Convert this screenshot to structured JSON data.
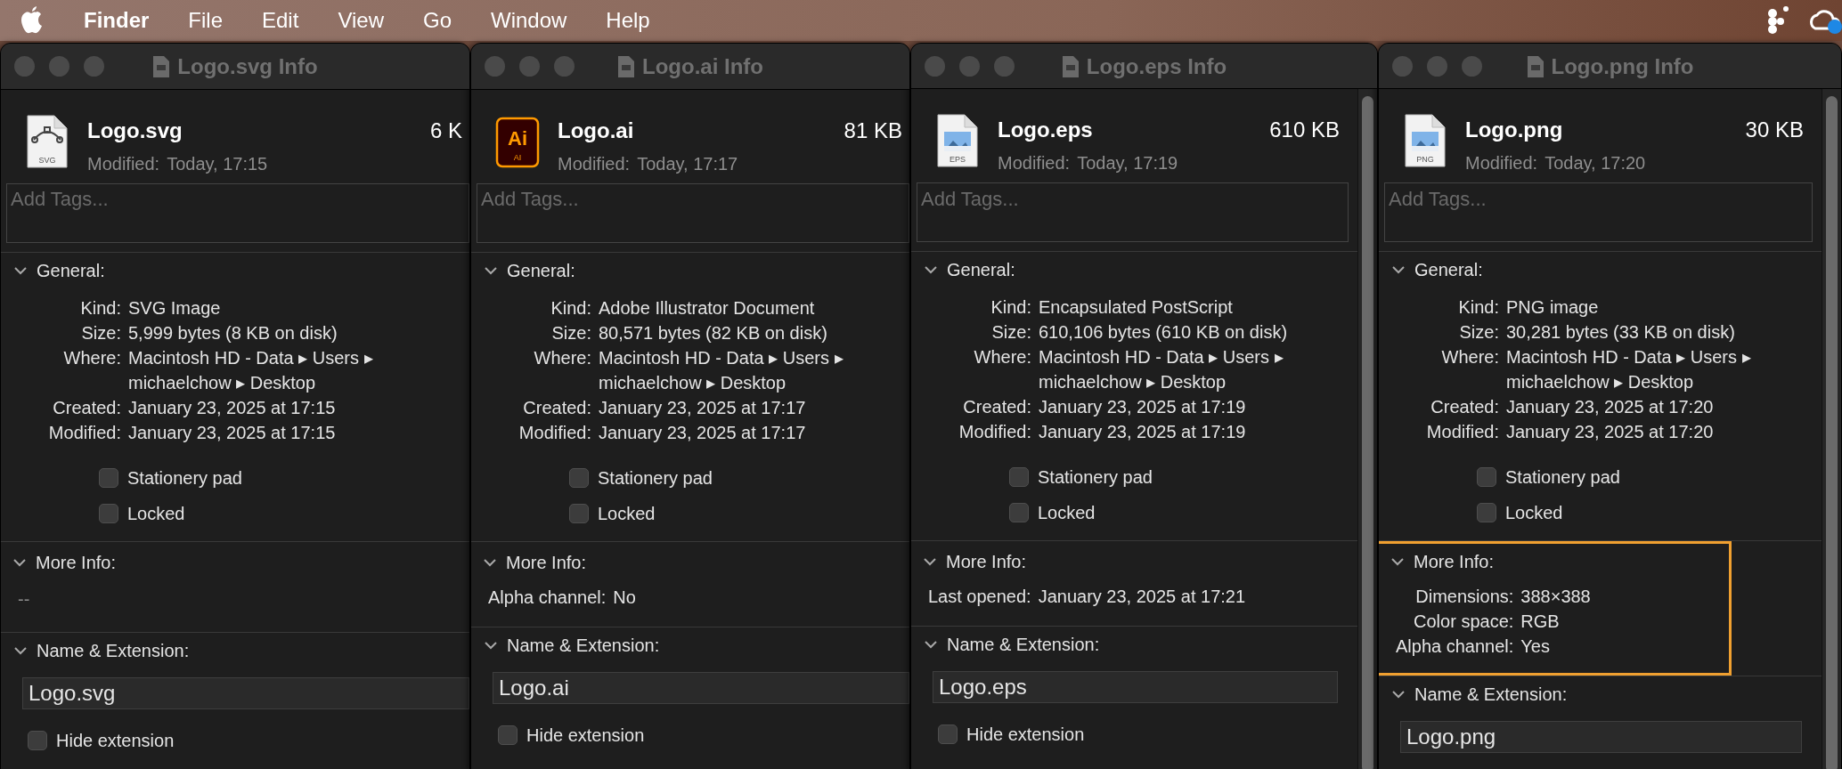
{
  "menu_bar": {
    "app_name": "Finder",
    "items": [
      "File",
      "Edit",
      "View",
      "Go",
      "Window",
      "Help"
    ]
  },
  "windows": [
    {
      "title": "Logo.svg Info",
      "kind": "svg",
      "icon_text": [
        "SVG"
      ],
      "name": "Logo.svg",
      "size": "6 K",
      "modified_label": "Modified:",
      "modified": "Today, 17:15",
      "tags_placeholder": "Add Tags...",
      "scrollbar": false,
      "general": {
        "heading": "General:",
        "expanded": true,
        "rows": [
          {
            "label": "Kind:",
            "value": "SVG Image"
          },
          {
            "label": "Size:",
            "value": "5,999 bytes (8 KB on disk)"
          },
          {
            "label": "Where:",
            "value": "Macintosh HD - Data ▸ Users ▸ michaelchow ▸ Desktop"
          },
          {
            "label": "Created:",
            "value": "January 23, 2025 at 17:15"
          },
          {
            "label": "Modified:",
            "value": "January 23, 2025 at 17:15"
          }
        ],
        "checkboxes": [
          {
            "label": "Stationery pad",
            "checked": false
          },
          {
            "label": "Locked",
            "checked": false
          }
        ]
      },
      "more_info": {
        "heading": "More Info:",
        "expanded": true,
        "highlighted": false,
        "note": "--"
      },
      "name_extension": {
        "heading": "Name & Extension:",
        "expanded": true,
        "value": "Logo.svg",
        "hide_extension": {
          "label": "Hide extension",
          "checked": false
        }
      }
    },
    {
      "title": "Logo.ai Info",
      "kind": "ai",
      "icon_text": [
        "Ai",
        "AI"
      ],
      "name": "Logo.ai",
      "size": "81 KB",
      "modified_label": "Modified:",
      "modified": "Today, 17:17",
      "tags_placeholder": "Add Tags...",
      "scrollbar": false,
      "general": {
        "heading": "General:",
        "expanded": true,
        "rows": [
          {
            "label": "Kind:",
            "value": "Adobe Illustrator Document"
          },
          {
            "label": "Size:",
            "value": "80,571 bytes (82 KB on disk)"
          },
          {
            "label": "Where:",
            "value": "Macintosh HD - Data ▸ Users ▸ michaelchow ▸ Desktop"
          },
          {
            "label": "Created:",
            "value": "January 23, 2025 at 17:17"
          },
          {
            "label": "Modified:",
            "value": "January 23, 2025 at 17:17"
          }
        ],
        "checkboxes": [
          {
            "label": "Stationery pad",
            "checked": false
          },
          {
            "label": "Locked",
            "checked": false
          }
        ]
      },
      "more_info": {
        "heading": "More Info:",
        "expanded": true,
        "highlighted": false,
        "rows": [
          {
            "label": "Alpha channel:",
            "value": "No"
          }
        ]
      },
      "name_extension": {
        "heading": "Name & Extension:",
        "expanded": true,
        "value": "Logo.ai",
        "hide_extension": {
          "label": "Hide extension",
          "checked": false
        }
      }
    },
    {
      "title": "Logo.eps Info",
      "kind": "eps",
      "icon_text": [
        "EPS"
      ],
      "name": "Logo.eps",
      "size": "610 KB",
      "modified_label": "Modified:",
      "modified": "Today, 17:19",
      "tags_placeholder": "Add Tags...",
      "scrollbar": true,
      "general": {
        "heading": "General:",
        "expanded": true,
        "rows": [
          {
            "label": "Kind:",
            "value": "Encapsulated PostScript"
          },
          {
            "label": "Size:",
            "value": "610,106 bytes (610 KB on disk)"
          },
          {
            "label": "Where:",
            "value": "Macintosh HD - Data ▸ Users ▸ michaelchow ▸ Desktop"
          },
          {
            "label": "Created:",
            "value": "January 23, 2025 at 17:19"
          },
          {
            "label": "Modified:",
            "value": "January 23, 2025 at 17:19"
          }
        ],
        "checkboxes": [
          {
            "label": "Stationery pad",
            "checked": false
          },
          {
            "label": "Locked",
            "checked": false
          }
        ]
      },
      "more_info": {
        "heading": "More Info:",
        "expanded": true,
        "highlighted": false,
        "rows": [
          {
            "label": "Last opened:",
            "value": "January 23, 2025 at 17:21"
          }
        ]
      },
      "name_extension": {
        "heading": "Name & Extension:",
        "expanded": true,
        "value": "Logo.eps",
        "hide_extension": {
          "label": "Hide extension",
          "checked": false
        }
      }
    },
    {
      "title": "Logo.png Info",
      "kind": "png",
      "icon_text": [
        "PNG"
      ],
      "name": "Logo.png",
      "size": "30 KB",
      "modified_label": "Modified:",
      "modified": "Today, 17:20",
      "tags_placeholder": "Add Tags...",
      "scrollbar": true,
      "general": {
        "heading": "General:",
        "expanded": true,
        "rows": [
          {
            "label": "Kind:",
            "value": "PNG image"
          },
          {
            "label": "Size:",
            "value": "30,281 bytes (33 KB on disk)"
          },
          {
            "label": "Where:",
            "value": "Macintosh HD - Data ▸ Users ▸ michaelchow ▸ Desktop"
          },
          {
            "label": "Created:",
            "value": "January 23, 2025 at 17:20"
          },
          {
            "label": "Modified:",
            "value": "January 23, 2025 at 17:20"
          }
        ],
        "checkboxes": [
          {
            "label": "Stationery pad",
            "checked": false
          },
          {
            "label": "Locked",
            "checked": false
          }
        ]
      },
      "more_info": {
        "heading": "More Info:",
        "expanded": true,
        "highlighted": true,
        "rows": [
          {
            "label": "Dimensions:",
            "value": "388×388"
          },
          {
            "label": "Color space:",
            "value": "RGB"
          },
          {
            "label": "Alpha channel:",
            "value": "Yes"
          }
        ]
      },
      "name_extension": {
        "heading": "Name & Extension:",
        "expanded": true,
        "value": "Logo.png"
      }
    }
  ]
}
